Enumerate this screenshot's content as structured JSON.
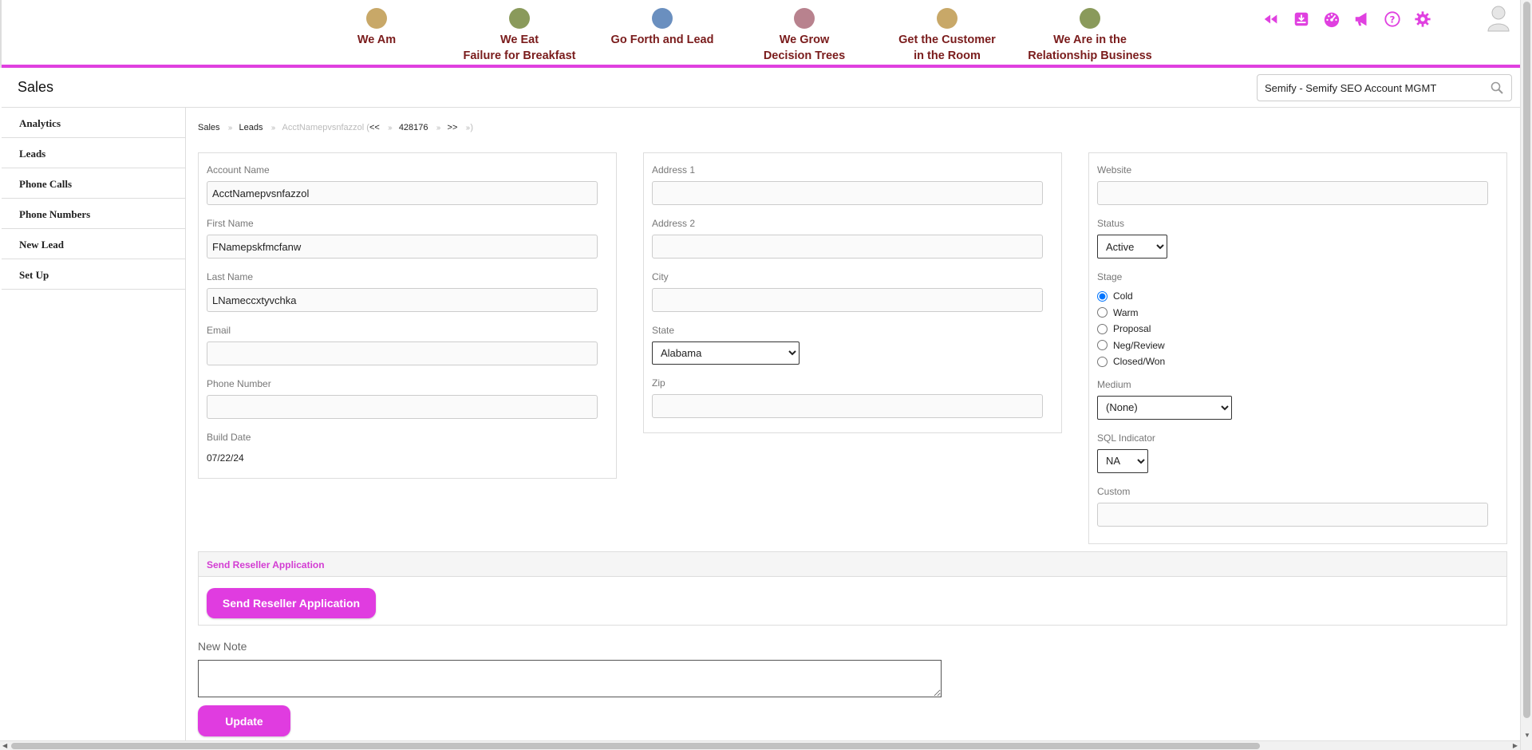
{
  "colors": {
    "accent": "#e040e0",
    "nav_text": "#7a1c1c",
    "button": "#e03ce0"
  },
  "top_nav": [
    {
      "label": "We Am",
      "dot_color": "#c8a868"
    },
    {
      "label": "We Eat\nFailure for Breakfast",
      "dot_color": "#8a9a5b"
    },
    {
      "label": "Go Forth and Lead",
      "dot_color": "#6a8fbf"
    },
    {
      "label": "We Grow\nDecision Trees",
      "dot_color": "#b8828e"
    },
    {
      "label": "Get the Customer\nin the Room",
      "dot_color": "#c8a868"
    },
    {
      "label": "We Are in the\nRelationship Business",
      "dot_color": "#8a9a5b"
    }
  ],
  "toolbar_icons": [
    "rewind-icon",
    "download-icon",
    "dashboard-icon",
    "megaphone-icon",
    "help-icon",
    "gear-icon"
  ],
  "header": {
    "title": "Sales",
    "search_value": "Semify - Semify SEO Account MGMT"
  },
  "sidebar": {
    "items": [
      "Analytics",
      "Leads",
      "Phone Calls",
      "Phone Numbers",
      "New Lead",
      "Set Up"
    ]
  },
  "breadcrumb": {
    "items": [
      "Sales",
      "Leads",
      "AcctNamepvsnfazzol (",
      "<<",
      "428176",
      ">>",
      ")"
    ]
  },
  "form": {
    "col1": {
      "account_name_label": "Account Name",
      "account_name": "AcctNamepvsnfazzol",
      "first_name_label": "First Name",
      "first_name": "FNamepskfmcfanw",
      "last_name_label": "Last Name",
      "last_name": "LNameccxtyvchka",
      "email_label": "Email",
      "email": "",
      "phone_label": "Phone Number",
      "phone": "",
      "build_date_label": "Build Date",
      "build_date": "07/22/24"
    },
    "col2": {
      "address1_label": "Address 1",
      "address1": "",
      "address2_label": "Address 2",
      "address2": "",
      "city_label": "City",
      "city": "",
      "state_label": "State",
      "state": "Alabama",
      "zip_label": "Zip",
      "zip": ""
    },
    "col3": {
      "website_label": "Website",
      "website": "",
      "status_label": "Status",
      "status": "Active",
      "stage_label": "Stage",
      "stages": [
        "Cold",
        "Warm",
        "Proposal",
        "Neg/Review",
        "Closed/Won"
      ],
      "stage_selected": "Cold",
      "medium_label": "Medium",
      "medium": "(None)",
      "sql_label": "SQL Indicator",
      "sql": "NA",
      "custom_label": "Custom",
      "custom": ""
    }
  },
  "reseller": {
    "heading": "Send Reseller Application",
    "button": "Send Reseller Application"
  },
  "note": {
    "label": "New Note",
    "value": ""
  },
  "update_button": "Update"
}
